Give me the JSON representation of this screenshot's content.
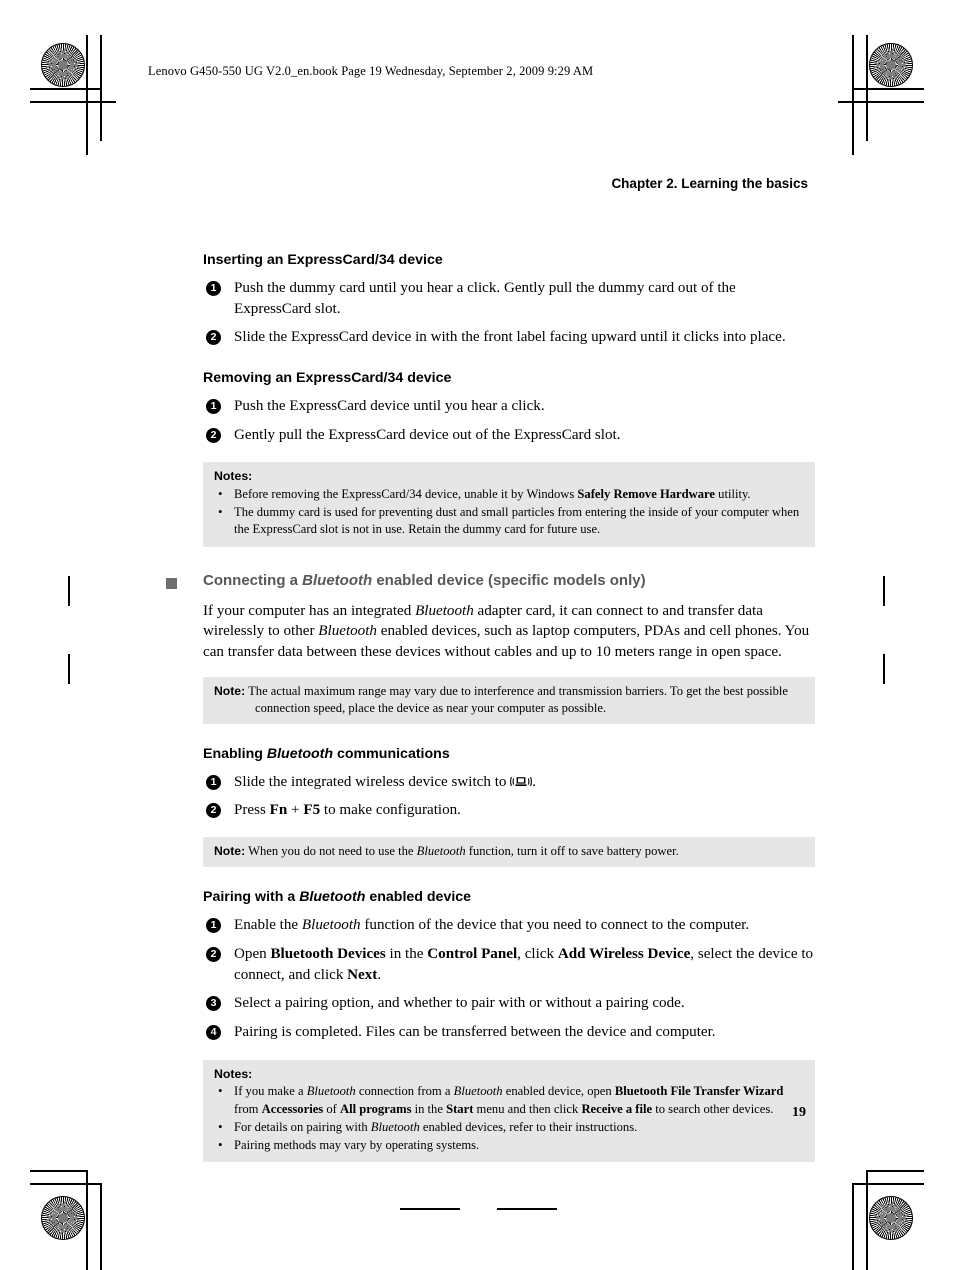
{
  "file_header": "Lenovo G450-550 UG V2.0_en.book  Page 19  Wednesday, September 2, 2009  9:29 AM",
  "chapter_title": "Chapter 2. Learning the basics",
  "page_number": "19",
  "sections": {
    "inserting": {
      "heading": "Inserting an ExpressCard/34 device",
      "steps": [
        {
          "num": "1",
          "text": "Push the dummy card until you hear a click. Gently pull the dummy card out of the ExpressCard slot."
        },
        {
          "num": "2",
          "text": "Slide the ExpressCard device in with the front label facing upward until it clicks into place."
        }
      ]
    },
    "removing": {
      "heading": "Removing an ExpressCard/34 device",
      "steps": [
        {
          "num": "1",
          "text": "Push the ExpressCard device until you hear a click."
        },
        {
          "num": "2",
          "text": "Gently pull the ExpressCard device out of the ExpressCard slot."
        }
      ]
    },
    "notes_expresscard": {
      "title": "Notes:",
      "items": [
        {
          "pre": "Before removing the ExpressCard/34 device, unable it by Windows ",
          "bold": "Safely Remove Hardware",
          "post": " utility."
        },
        {
          "pre": "The dummy card is used for preventing dust and small particles from entering the inside of your computer when the ExpressCard slot is not in use. Retain the dummy card for future use.",
          "bold": "",
          "post": ""
        }
      ]
    },
    "bluetooth_heading": {
      "pre": "Connecting a ",
      "italic": "Bluetooth",
      "post": " enabled device (specific models only)"
    },
    "bluetooth_body": {
      "p1": "If your computer has an integrated ",
      "it1": "Bluetooth",
      "p2": " adapter card, it can connect to and transfer data wirelessly to other ",
      "it2": "Bluetooth",
      "p3": " enabled devices, such as laptop computers, PDAs and cell phones. You can transfer data between these devices without cables and up to 10 meters range in open space."
    },
    "note_range": {
      "label": "Note:",
      "text": " The actual maximum range may vary due to interference and transmission barriers. To get the best possible connection speed, place the device as near your computer as possible."
    },
    "enabling": {
      "heading_pre": "Enabling ",
      "heading_italic": "Bluetooth",
      "heading_post": " communications",
      "step1_pre": "Slide the integrated wireless device switch to ",
      "step1_icon": "wireless-switch-icon",
      "step1_post": ".",
      "step2_pre": "Press ",
      "step2_key1": "Fn",
      "step2_mid": " + ",
      "step2_key2": "F5",
      "step2_post": " to make configuration."
    },
    "note_battery": {
      "label": "Note:",
      "pre": " When you do not need to use the ",
      "italic": "Bluetooth",
      "post": " function, turn it off to save battery power."
    },
    "pairing": {
      "heading_pre": "Pairing with a ",
      "heading_italic": "Bluetooth",
      "heading_post": " enabled device",
      "step1_pre": "Enable the ",
      "step1_italic": "Bluetooth",
      "step1_post": " function of the device that you need to connect to the computer.",
      "step2_a": "Open ",
      "step2_b1": "Bluetooth Devices",
      "step2_c": " in the ",
      "step2_b2": "Control Panel",
      "step2_d": ", click ",
      "step2_b3": "Add Wireless Device",
      "step2_e": ", select the device to connect, and click ",
      "step2_b4": "Next",
      "step2_f": ".",
      "step3": "Select a pairing option, and whether to pair with or without a pairing code.",
      "step4": "Pairing is completed. Files can be transferred between the device and computer."
    },
    "notes_pairing": {
      "title": "Notes:",
      "item1": {
        "a": "If you make a ",
        "i1": "Bluetooth",
        "b": " connection from a ",
        "i2": "Bluetooth",
        "c": " enabled device, open ",
        "bold1": "Bluetooth File Transfer Wizard",
        "d": " from ",
        "bold2": "Accessories",
        "e": " of ",
        "bold3": "All programs",
        "f": " in the ",
        "bold4": "Start",
        "g": " menu and then click ",
        "bold5": "Receive a file",
        "h": " to search other devices."
      },
      "item2": {
        "a": "For details on pairing with ",
        "i1": "Bluetooth",
        "b": " enabled devices, refer to their instructions."
      },
      "item3": "Pairing methods may vary by operating systems."
    }
  },
  "colors": {
    "note_background": "#e6e6e6",
    "heading_gray": "#585858",
    "square_bullet": "#6e6e6e"
  }
}
